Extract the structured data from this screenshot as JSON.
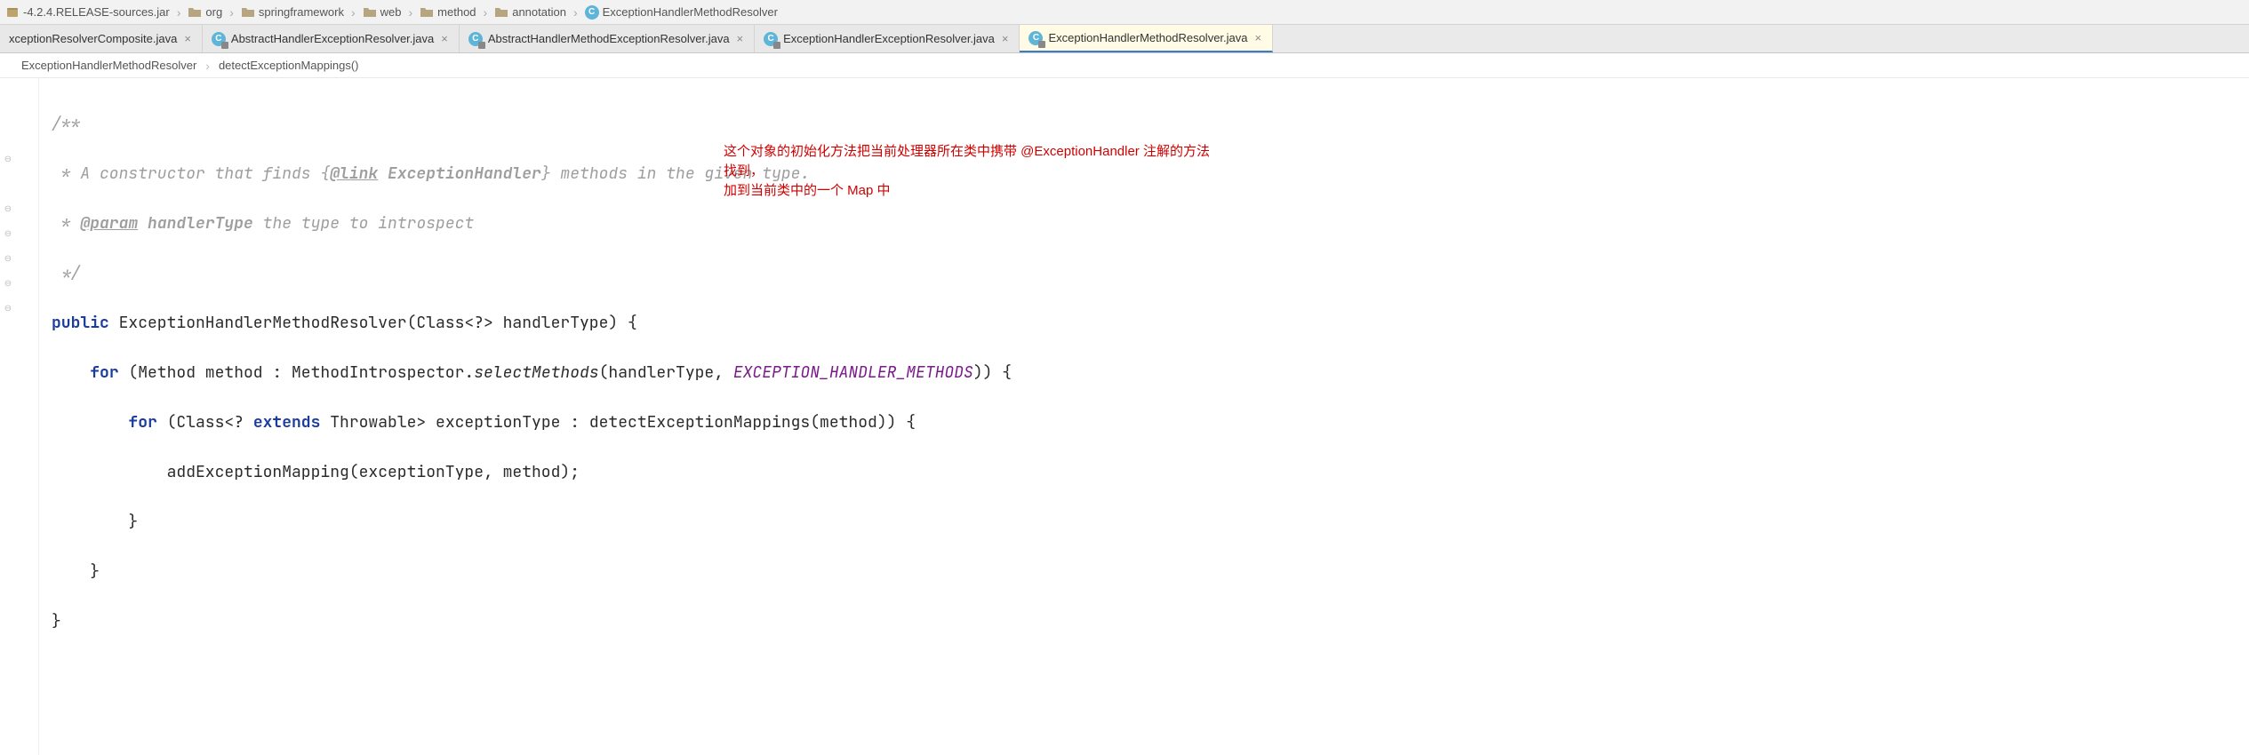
{
  "breadcrumb": {
    "items": [
      {
        "label": "-4.2.4.RELEASE-sources.jar",
        "iconType": "jar"
      },
      {
        "label": "org",
        "iconType": "folder"
      },
      {
        "label": "springframework",
        "iconType": "folder"
      },
      {
        "label": "web",
        "iconType": "folder"
      },
      {
        "label": "method",
        "iconType": "folder"
      },
      {
        "label": "annotation",
        "iconType": "folder"
      },
      {
        "label": "ExceptionHandlerMethodResolver",
        "iconType": "class"
      }
    ]
  },
  "tabs": [
    {
      "label": "xceptionResolverComposite.java",
      "active": false
    },
    {
      "label": "AbstractHandlerExceptionResolver.java",
      "active": false
    },
    {
      "label": "AbstractHandlerMethodExceptionResolver.java",
      "active": false
    },
    {
      "label": "ExceptionHandlerExceptionResolver.java",
      "active": false
    },
    {
      "label": "ExceptionHandlerMethodResolver.java",
      "active": true
    }
  ],
  "member": {
    "class": "ExceptionHandlerMethodResolver",
    "method": "detectExceptionMappings()"
  },
  "code": {
    "l1": "/**",
    "l2a": " * A constructor that finds {",
    "l2b": "@link",
    "l2c": " ",
    "l2d": "ExceptionHandler",
    "l2e": "} methods in the given type.",
    "l3a": " * ",
    "l3b": "@param",
    "l3c": " ",
    "l3d": "handlerType",
    "l3e": " the type to introspect",
    "l4": " */",
    "l5kw": "public",
    "l5": " ExceptionHandlerMethodResolver(Class<?> handlerType) {",
    "l6kw": "for",
    "l6a": " (Method method : MethodIntrospector.",
    "l6b": "selectMethods",
    "l6c": "(handlerType, ",
    "l6d": "EXCEPTION_HANDLER_METHODS",
    "l6e": ")) {",
    "l7kw": "for",
    "l7a": " (Class<? ",
    "l7kw2": "extends",
    "l7b": " Throwable> exceptionType : detectExceptionMappings(method)) {",
    "l8": "addExceptionMapping(exceptionType, method);",
    "l9": "}",
    "l10": "}",
    "l11": "}"
  },
  "annotation": {
    "line1": "这个对象的初始化方法把当前处理器所在类中携带 @ExceptionHandler 注解的方法找到，",
    "line2": "加到当前类中的一个 Map 中"
  },
  "icons": {
    "classLetter": "C",
    "closeGlyph": "×",
    "chevron": "›"
  }
}
